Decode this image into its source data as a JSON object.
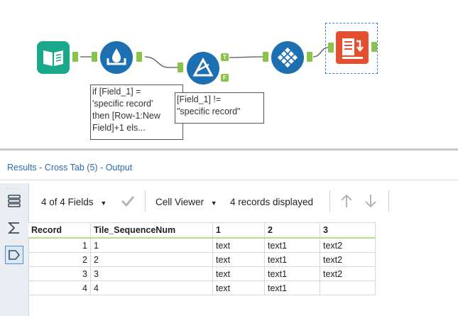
{
  "workflow": {
    "tools": [
      {
        "name": "input-data-tool",
        "icon": "book-icon",
        "color": "#19a88a"
      },
      {
        "name": "multi-row-formula-tool",
        "icon": "water-drop-icon",
        "color": "#1c6fb0"
      },
      {
        "name": "filter-tool",
        "icon": "filter-triangle-icon",
        "color": "#1c6fb0"
      },
      {
        "name": "tile-tool",
        "icon": "diamond-grid-icon",
        "color": "#1c6fb0"
      },
      {
        "name": "cross-tab-tool",
        "icon": "cross-tab-icon",
        "color": "#e4502f"
      }
    ],
    "filter_true_label": "T",
    "filter_false_label": "F",
    "annotation_formula": "if [Field_1] =\n'specific record'\nthen [Row-1:New\nField]+1 els...",
    "annotation_filter": "[Field_1] !=\n\"specific record\""
  },
  "results": {
    "title": "Results - Cross Tab (5) - Output",
    "rail_dots": "·····",
    "toolbar": {
      "fields_label": "4 of 4 Fields",
      "cell_viewer_label": "Cell Viewer",
      "records_label": "4 records displayed"
    },
    "columns": [
      "Record",
      "Tile_SequenceNum",
      "1",
      "2",
      "3"
    ],
    "rows": [
      [
        "1",
        "1",
        "text",
        "text1",
        "text2"
      ],
      [
        "2",
        "2",
        "text",
        "text1",
        "text2"
      ],
      [
        "3",
        "3",
        "text",
        "text1",
        "text2"
      ],
      [
        "4",
        "4",
        "text",
        "text1",
        ""
      ]
    ]
  },
  "colors": {
    "anchor_green": "#8bc34a",
    "link_blue": "#2a6bb0"
  }
}
